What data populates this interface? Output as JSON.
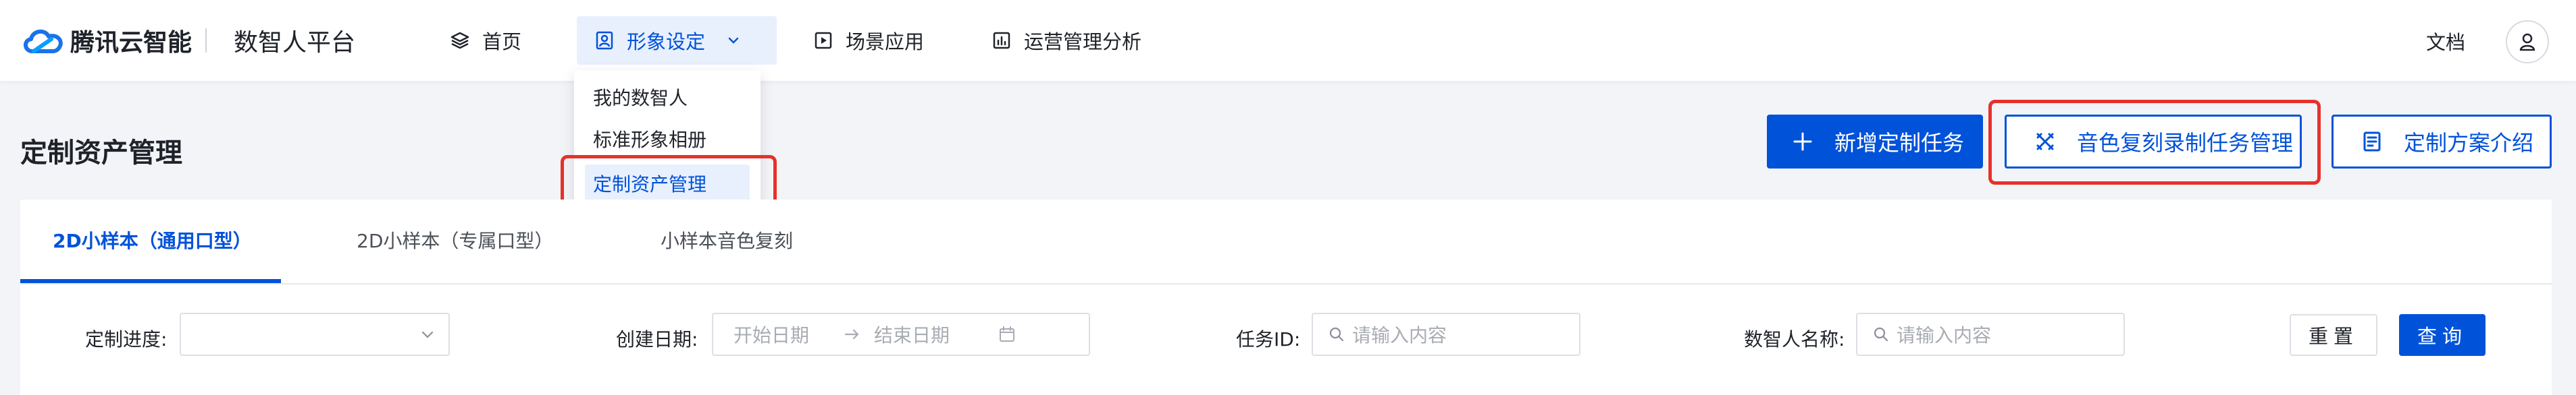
{
  "header": {
    "brand": "腾讯云智能",
    "platform": "数智人平台",
    "nav": [
      {
        "label": "首页",
        "icon": "layers-icon"
      },
      {
        "label": "形象设定",
        "icon": "portrait-icon",
        "active": true
      },
      {
        "label": "场景应用",
        "icon": "play-icon"
      },
      {
        "label": "运营管理分析",
        "icon": "chart-icon"
      }
    ],
    "docs_label": "文档",
    "user_icon": "user-icon"
  },
  "dropdown": {
    "items": [
      "我的数智人",
      "标准形象相册",
      "定制资产管理"
    ],
    "selected": "定制资产管理"
  },
  "page": {
    "title": "定制资产管理",
    "actions": {
      "new_task": "新增定制任务",
      "voice_task": "音色复刻录制任务管理",
      "plan_intro": "定制方案介绍"
    }
  },
  "tabs": [
    "2D小样本（通用口型）",
    "2D小样本（专属口型）",
    "小样本音色复刻"
  ],
  "active_tab": 0,
  "filters": {
    "progress_label": "定制进度:",
    "date_label": "创建日期:",
    "start_placeholder": "开始日期",
    "end_placeholder": "结束日期",
    "task_id_label": "任务ID:",
    "task_id_placeholder": "请输入内容",
    "name_label": "数智人名称:",
    "name_placeholder": "请输入内容",
    "reset": "重置",
    "query": "查询"
  },
  "colors": {
    "accent": "#0052d9",
    "highlight": "#e6312b",
    "active_bg": "#e8f0fd"
  }
}
